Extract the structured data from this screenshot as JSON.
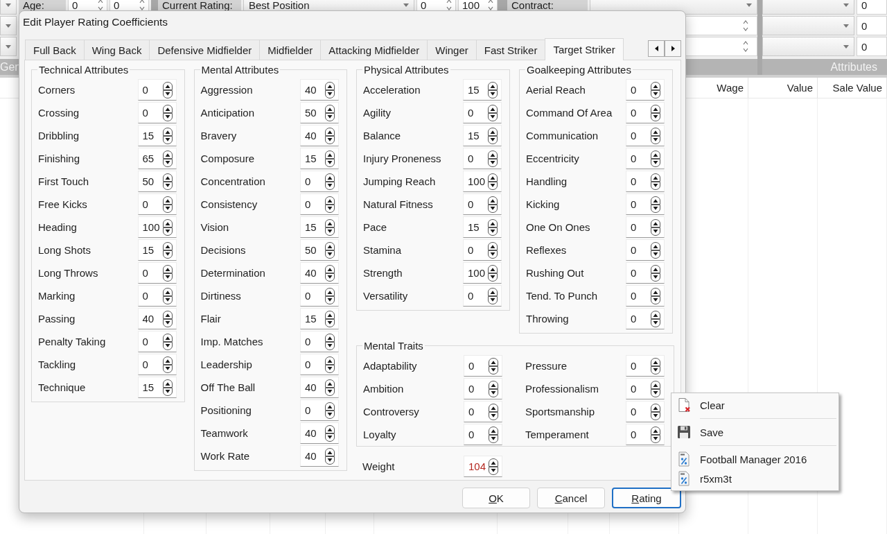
{
  "app": {
    "panels": [
      {
        "rows": [
          [
            {
              "kind": "dropdown"
            },
            {
              "kind": "label",
              "text": "Age:"
            },
            {
              "kind": "spin",
              "value": "0"
            },
            {
              "kind": "spin",
              "value": "0"
            }
          ],
          [
            {
              "kind": "dropdown"
            }
          ],
          [
            {
              "kind": "dropdown"
            }
          ]
        ],
        "caption": "Gen"
      },
      {
        "rows": [
          [
            {
              "kind": "label",
              "text": "Current Rating:"
            },
            {
              "kind": "dropdown",
              "value": "Best Position"
            },
            {
              "kind": "spin",
              "value": "0"
            },
            {
              "kind": "spin",
              "value": "100"
            }
          ]
        ]
      },
      {
        "rows": [
          [
            {
              "kind": "label",
              "text": "Contract:"
            },
            {
              "kind": "dropdown"
            }
          ],
          [
            {
              "kind": "spin"
            }
          ],
          [
            {
              "kind": "spin"
            }
          ]
        ]
      },
      {
        "rows": [
          [
            {
              "kind": "dropdown"
            },
            {
              "kind": "field",
              "value": "0"
            }
          ],
          [
            {
              "kind": "dropdown"
            },
            {
              "kind": "field",
              "value": "0"
            }
          ],
          [
            {
              "kind": "dropdown"
            },
            {
              "kind": "field",
              "value": "0"
            }
          ]
        ],
        "caption": "Attributes"
      }
    ]
  },
  "table": {
    "columns": [
      "Wage",
      "Value",
      "Sale Value"
    ]
  },
  "dialog": {
    "title": "Edit Player Rating Coefficients",
    "tabs": [
      {
        "label": "Full Back",
        "selected": false
      },
      {
        "label": "Wing Back",
        "selected": false
      },
      {
        "label": "Defensive Midfielder",
        "selected": false
      },
      {
        "label": "Midfielder",
        "selected": false
      },
      {
        "label": "Attacking Midfielder",
        "selected": false
      },
      {
        "label": "Winger",
        "selected": false
      },
      {
        "label": "Fast Striker",
        "selected": false
      },
      {
        "label": "Target Striker",
        "selected": true
      }
    ],
    "groups": [
      {
        "title": "Technical Attributes",
        "rows": [
          {
            "label": "Corners",
            "value": "0"
          },
          {
            "label": "Crossing",
            "value": "0"
          },
          {
            "label": "Dribbling",
            "value": "15"
          },
          {
            "label": "Finishing",
            "value": "65"
          },
          {
            "label": "First Touch",
            "value": "50"
          },
          {
            "label": "Free Kicks",
            "value": "0"
          },
          {
            "label": "Heading",
            "value": "100"
          },
          {
            "label": "Long Shots",
            "value": "15"
          },
          {
            "label": "Long Throws",
            "value": "0"
          },
          {
            "label": "Marking",
            "value": "0"
          },
          {
            "label": "Passing",
            "value": "40"
          },
          {
            "label": "Penalty Taking",
            "value": "0"
          },
          {
            "label": "Tackling",
            "value": "0"
          },
          {
            "label": "Technique",
            "value": "15"
          }
        ]
      },
      {
        "title": "Mental Attributes",
        "rows": [
          {
            "label": "Aggression",
            "value": "40"
          },
          {
            "label": "Anticipation",
            "value": "50"
          },
          {
            "label": "Bravery",
            "value": "40"
          },
          {
            "label": "Composure",
            "value": "15"
          },
          {
            "label": "Concentration",
            "value": "0"
          },
          {
            "label": "Consistency",
            "value": "0"
          },
          {
            "label": "Vision",
            "value": "15"
          },
          {
            "label": "Decisions",
            "value": "50"
          },
          {
            "label": "Determination",
            "value": "40"
          },
          {
            "label": "Dirtiness",
            "value": "0"
          },
          {
            "label": "Flair",
            "value": "15"
          },
          {
            "label": "Imp. Matches",
            "value": "0"
          },
          {
            "label": "Leadership",
            "value": "0"
          },
          {
            "label": "Off The Ball",
            "value": "40"
          },
          {
            "label": "Positioning",
            "value": "0"
          },
          {
            "label": "Teamwork",
            "value": "40"
          },
          {
            "label": "Work Rate",
            "value": "40"
          }
        ]
      },
      {
        "title": "Physical Attributes",
        "rows": [
          {
            "label": "Acceleration",
            "value": "15"
          },
          {
            "label": "Agility",
            "value": "0"
          },
          {
            "label": "Balance",
            "value": "15"
          },
          {
            "label": "Injury Proneness",
            "value": "0"
          },
          {
            "label": "Jumping Reach",
            "value": "100"
          },
          {
            "label": "Natural Fitness",
            "value": "0"
          },
          {
            "label": "Pace",
            "value": "15"
          },
          {
            "label": "Stamina",
            "value": "0"
          },
          {
            "label": "Strength",
            "value": "100"
          },
          {
            "label": "Versatility",
            "value": "0"
          }
        ]
      },
      {
        "title": "Goalkeeping Attributes",
        "rows": [
          {
            "label": "Aerial Reach",
            "value": "0"
          },
          {
            "label": "Command Of Area",
            "value": "0"
          },
          {
            "label": "Communication",
            "value": "0"
          },
          {
            "label": "Eccentricity",
            "value": "0"
          },
          {
            "label": "Handling",
            "value": "0"
          },
          {
            "label": "Kicking",
            "value": "0"
          },
          {
            "label": "One On Ones",
            "value": "0"
          },
          {
            "label": "Reflexes",
            "value": "0"
          },
          {
            "label": "Rushing Out",
            "value": "0"
          },
          {
            "label": "Tend. To Punch",
            "value": "0"
          },
          {
            "label": "Throwing",
            "value": "0"
          }
        ]
      }
    ],
    "traits": {
      "title": "Mental Traits",
      "columns": [
        [
          {
            "label": "Adaptability",
            "value": "0"
          },
          {
            "label": "Ambition",
            "value": "0"
          },
          {
            "label": "Controversy",
            "value": "0"
          },
          {
            "label": "Loyalty",
            "value": "0"
          }
        ],
        [
          {
            "label": "Pressure",
            "value": "0"
          },
          {
            "label": "Professionalism",
            "value": "0"
          },
          {
            "label": "Sportsmanship",
            "value": "0"
          },
          {
            "label": "Temperament",
            "value": "0"
          }
        ]
      ]
    },
    "weight": {
      "label": "Weight",
      "value": "104",
      "error": true
    },
    "buttons": [
      {
        "label": "OK",
        "focused": false
      },
      {
        "label": "Cancel",
        "focused": false
      },
      {
        "label": "Rating",
        "focused": true
      }
    ]
  },
  "context_menu": {
    "items": [
      {
        "kind": "clear",
        "label": "Clear"
      },
      {
        "kind": "separator"
      },
      {
        "kind": "save",
        "label": "Save"
      },
      {
        "kind": "separator"
      },
      {
        "kind": "profile",
        "label": "Football Manager 2016"
      },
      {
        "kind": "profile",
        "label": "r5xm3t"
      }
    ]
  }
}
